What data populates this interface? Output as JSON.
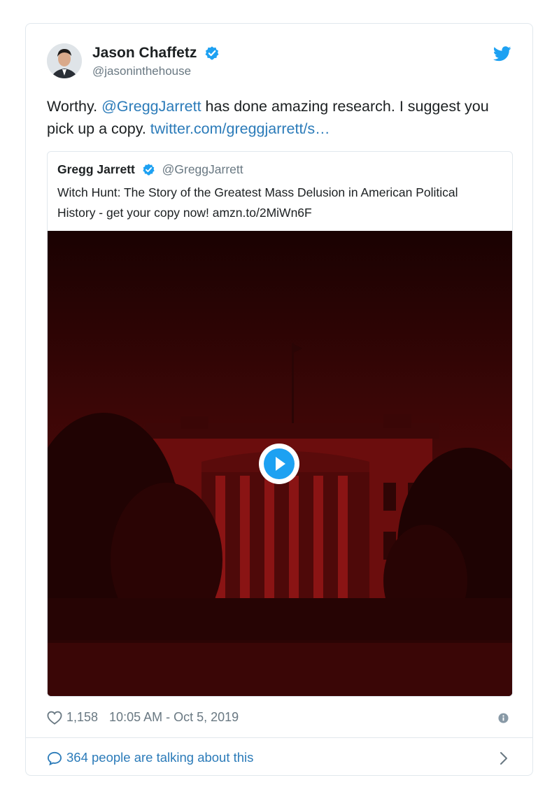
{
  "author": {
    "display_name": "Jason Chaffetz",
    "handle": "@jasoninthehouse"
  },
  "tweet": {
    "text_before": "Worthy. ",
    "mention": "@GreggJarrett",
    "text_middle": " has done amazing research.  I suggest you pick up a copy. ",
    "link": "twitter.com/greggjarrett/s…"
  },
  "quoted": {
    "display_name": "Gregg Jarrett",
    "handle": "@GreggJarrett",
    "text": "Witch Hunt: The Story of the Greatest Mass Delusion in American Political History - get your copy now! amzn.to/2MiWn6F"
  },
  "footer": {
    "likes": "1,158",
    "timestamp": "10:05 AM - Oct 5, 2019",
    "conversation": "364 people are talking about this"
  },
  "icons": {
    "verified": "verified-badge-icon",
    "bird": "twitter-bird-icon",
    "play": "play-icon",
    "heart": "heart-icon",
    "info": "info-icon",
    "bubble": "speech-bubble-icon",
    "chevron": "chevron-right-icon"
  },
  "colors": {
    "accent": "#1da1f2",
    "link": "#2b7bb9",
    "muted": "#697882",
    "media_tint": "#5a0a0a"
  }
}
